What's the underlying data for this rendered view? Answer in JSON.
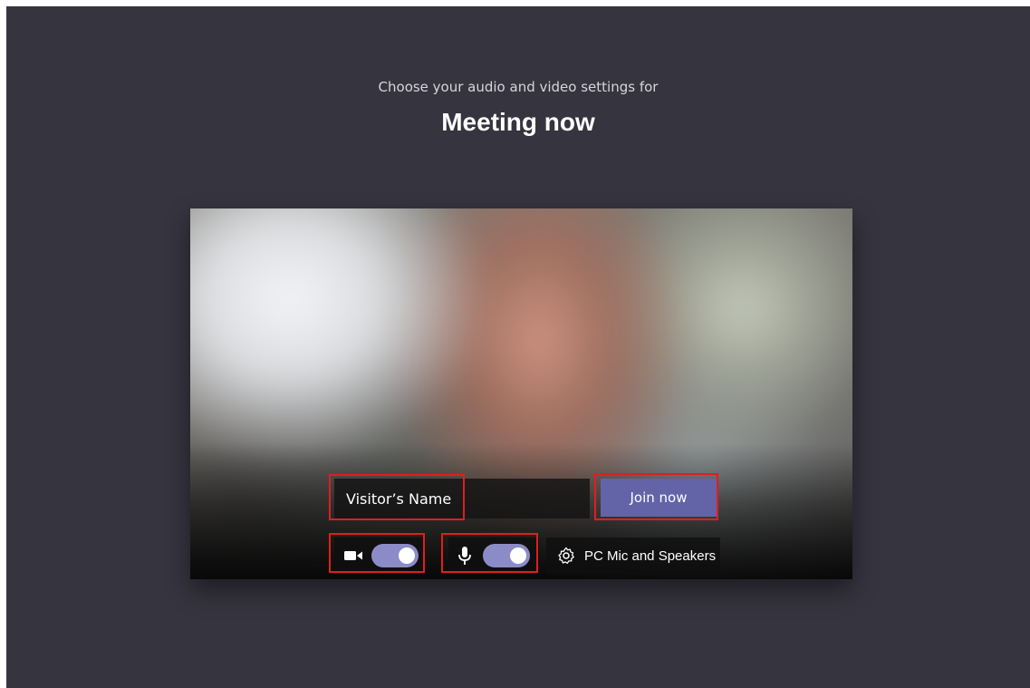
{
  "prejoin": {
    "subtitle": "Choose your audio and video settings for",
    "meeting_title": "Meeting now"
  },
  "name_field": {
    "value": "Visitor’s Name"
  },
  "join_button": {
    "label": "Join now"
  },
  "camera_toggle": {
    "state": "on"
  },
  "mic_toggle": {
    "state": "on"
  },
  "device_settings": {
    "label": "PC Mic and Speakers"
  },
  "colors": {
    "background": "#36343f",
    "accent": "#6264a7",
    "toggle_on": "#8b8cc7",
    "highlight": "#e01e1e"
  },
  "icons": [
    "video-camera-icon",
    "microphone-icon",
    "gear-icon"
  ]
}
